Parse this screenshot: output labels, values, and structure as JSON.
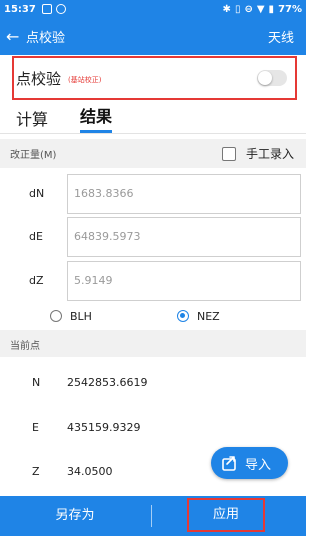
{
  "status_bar": {
    "time": "15:37",
    "battery": "77%"
  },
  "app_bar": {
    "title": "点校验",
    "right_action": "天线"
  },
  "point_check": {
    "label": "点校验",
    "note": "(基站校正)",
    "enabled": false
  },
  "tabs": [
    {
      "label": "计算",
      "active": false
    },
    {
      "label": "结果",
      "active": true
    }
  ],
  "correction": {
    "header": "改正量(M)",
    "manual_input_label": "手工录入",
    "manual_checked": false,
    "rows": [
      {
        "label": "dN",
        "value": "1683.8366"
      },
      {
        "label": "dE",
        "value": "64839.5973"
      },
      {
        "label": "dZ",
        "value": "5.9149"
      }
    ]
  },
  "coord_mode": {
    "options": [
      "BLH",
      "NEZ"
    ],
    "selected": "NEZ"
  },
  "current_point": {
    "header": "当前点",
    "rows": [
      {
        "label": "N",
        "value": "2542853.6619"
      },
      {
        "label": "E",
        "value": "435159.9329"
      },
      {
        "label": "Z",
        "value": "34.0500"
      }
    ]
  },
  "import_button": {
    "label": "导入"
  },
  "bottom_bar": {
    "save_as": "另存为",
    "apply": "应用"
  },
  "colors": {
    "primary": "#1f84e6",
    "highlight": "#e53935"
  }
}
